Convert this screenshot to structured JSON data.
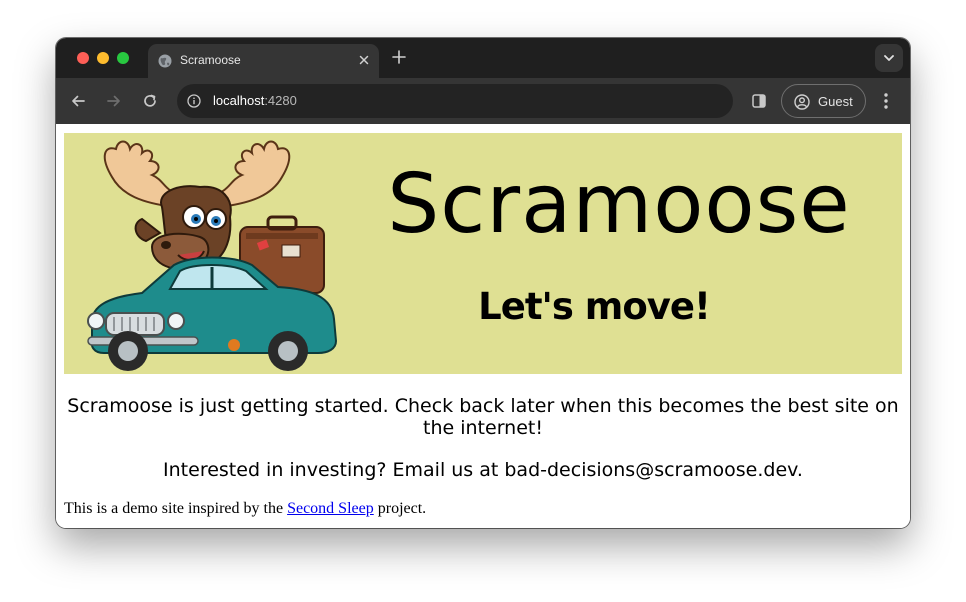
{
  "browser": {
    "tab": {
      "title": "Scramoose",
      "icon": "globe-icon"
    },
    "address": {
      "host": "localhost",
      "port": ":4280"
    },
    "profile_label": "Guest"
  },
  "page": {
    "banner": {
      "title": "Scramoose",
      "tagline": "Let's move!",
      "illustration": "moose-driving-car"
    },
    "intro": "Scramoose is just getting started. Check back later when this becomes the best site on the internet!",
    "invest": "Interested in investing? Email us at bad-decisions@scramoose.dev.",
    "footer": {
      "prefix": "This is a demo site inspired by the ",
      "link_text": "Second Sleep",
      "suffix": " project."
    }
  },
  "colors": {
    "banner_bg": "#dfe093",
    "link": "#0000ee",
    "chrome_dark": "#1f1f1f",
    "toolbar": "#353535"
  }
}
